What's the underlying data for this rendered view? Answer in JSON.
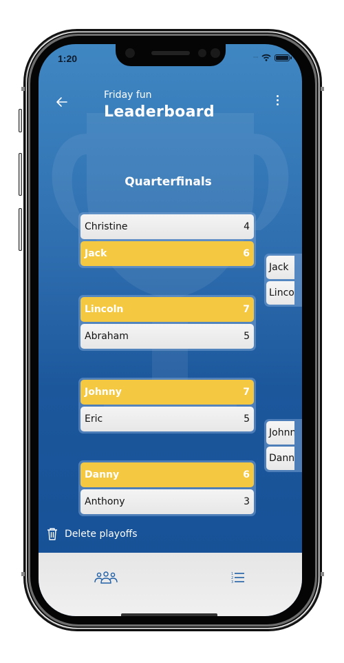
{
  "status_bar": {
    "time": "1:20",
    "signal_icon": "signal-dots-icon",
    "wifi_icon": "wifi-icon",
    "battery_icon": "battery-full-icon"
  },
  "header": {
    "back_icon": "arrow-left-icon",
    "subtitle": "Friday fun",
    "title": "Leaderboard",
    "menu_icon": "more-vertical-icon"
  },
  "bracket": {
    "round_title": "Quarterfinals",
    "matches": [
      {
        "players": [
          {
            "name": "Christine",
            "score": "4",
            "winner": false
          },
          {
            "name": "Jack",
            "score": "6",
            "winner": true
          }
        ]
      },
      {
        "players": [
          {
            "name": "Lincoln",
            "score": "7",
            "winner": true
          },
          {
            "name": "Abraham",
            "score": "5",
            "winner": false
          }
        ]
      },
      {
        "players": [
          {
            "name": "Johnny",
            "score": "7",
            "winner": true
          },
          {
            "name": "Eric",
            "score": "5",
            "winner": false
          }
        ]
      },
      {
        "players": [
          {
            "name": "Danny",
            "score": "6",
            "winner": true
          },
          {
            "name": "Anthony",
            "score": "3",
            "winner": false
          }
        ]
      }
    ],
    "next_round_matches": [
      {
        "players": [
          "Jack",
          "Lincoln"
        ]
      },
      {
        "players": [
          "Johnny",
          "Danny"
        ]
      }
    ]
  },
  "actions": {
    "delete_icon": "trash-icon",
    "delete_label": "Delete playoffs"
  },
  "bottom_nav": {
    "items": [
      {
        "id": "teams",
        "icon": "group-icon"
      },
      {
        "id": "standings",
        "icon": "numbered-list-icon"
      }
    ]
  },
  "colors": {
    "accent_blue": "#1f5fa6",
    "winner_yellow": "#f5c842",
    "loser_gray": "#ececec",
    "nav_bg": "#ebebeb"
  }
}
